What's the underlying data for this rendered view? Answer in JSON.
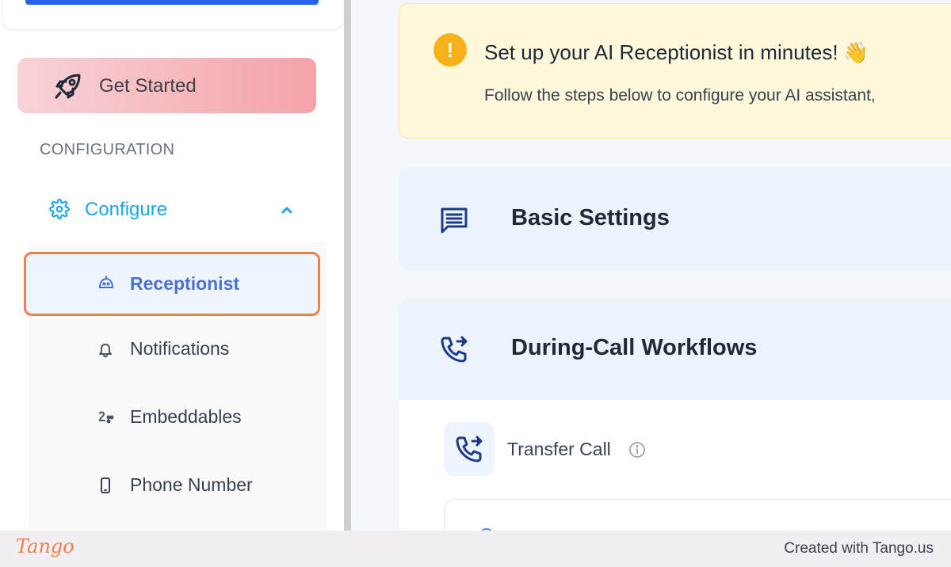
{
  "sidebar": {
    "get_started": {
      "label": "Get Started",
      "icon": "rocket-icon"
    },
    "section_label": "CONFIGURATION",
    "configure": {
      "label": "Configure",
      "icon": "gear-icon",
      "expanded": true
    },
    "items": [
      {
        "label": "Receptionist",
        "icon": "robot-icon",
        "active": true
      },
      {
        "label": "Notifications",
        "icon": "bell-icon",
        "active": false
      },
      {
        "label": "Embeddables",
        "icon": "embed-icon",
        "active": false
      },
      {
        "label": "Phone Number",
        "icon": "phone-icon",
        "active": false
      }
    ]
  },
  "main": {
    "banner": {
      "title": "Set up your AI Receptionist in minutes!",
      "emoji": "👋",
      "subtitle": "Follow the steps below to configure your AI assistant,"
    },
    "sections": [
      {
        "label": "Basic Settings",
        "icon": "chat-lines-icon"
      },
      {
        "label": "During-Call Workflows",
        "icon": "phone-transfer-icon"
      }
    ],
    "workflows": [
      {
        "label": "Transfer Call",
        "icon": "phone-transfer-icon"
      }
    ]
  },
  "footer": {
    "logo": "Tango",
    "credit": "Created with Tango.us"
  },
  "colors": {
    "accent_blue": "#1aa6e8",
    "active_text": "#4a6fd6",
    "highlight_border": "#ef7f4a",
    "warning": "#f7b21b",
    "banner_bg": "#fff9dc"
  }
}
